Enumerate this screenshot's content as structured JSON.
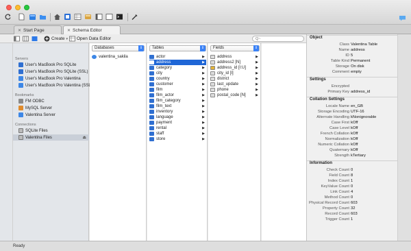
{
  "tabs": [
    {
      "label": "Start Page",
      "active": false
    },
    {
      "label": "Schema Editor",
      "active": true
    }
  ],
  "secondary_toolbar": {
    "create_label": "Create",
    "open_data_editor_label": "Open Data Editor",
    "search_placeholder": "Q~"
  },
  "sidebar": {
    "servers_header": "Servers",
    "servers": [
      "User's MacBook Pro SQLite",
      "User's MacBook Pro SQLite (SSL)",
      "User's MacBook Pro Valentina",
      "User's MacBook Pro Valentina (SSL)"
    ],
    "bookmarks_header": "Bookmarks",
    "bookmarks": [
      "FM ODBC",
      "MySQL Server",
      "Valentina Server"
    ],
    "connections_header": "Connections",
    "connections": [
      "SQLite Files",
      "Valentina Files"
    ]
  },
  "databases": {
    "header": "Databases",
    "items": [
      "valentina_sakila"
    ]
  },
  "tables": {
    "header": "Tables",
    "items": [
      "actor",
      "address",
      "category",
      "city",
      "country",
      "customer",
      "film",
      "film_actor",
      "film_category",
      "film_text",
      "inventory",
      "language",
      "payment",
      "rental",
      "staff",
      "store"
    ],
    "selected": "address"
  },
  "fields": {
    "header": "Fields",
    "items": [
      "address",
      "address2 [N]",
      "address_id [I:U]",
      "city_id [I]",
      "district",
      "last_update",
      "phone",
      "postal_code [N]"
    ]
  },
  "inspector": {
    "object_title": "Object",
    "object": [
      {
        "k": "Class",
        "v": "Valentina Table"
      },
      {
        "k": "Name",
        "v": "address"
      },
      {
        "k": "ID",
        "v": "5"
      },
      {
        "k": "Table Kind",
        "v": "Permanent"
      },
      {
        "k": "Storage",
        "v": "On disk"
      },
      {
        "k": "Comment",
        "v": "empty"
      }
    ],
    "settings_title": "Settings",
    "settings": [
      {
        "k": "Encrypted",
        "v": ""
      },
      {
        "k": "Primary Key",
        "v": "address_id"
      }
    ],
    "collation_title": "Collation Settings",
    "collation": [
      {
        "k": "Locale Name",
        "v": "en_GB"
      },
      {
        "k": "Storage Encoding",
        "v": "UTF-16"
      },
      {
        "k": "Alternate Handling",
        "v": "kNonignorable"
      },
      {
        "k": "Case First",
        "v": "kOff"
      },
      {
        "k": "Case Level",
        "v": "kOff"
      },
      {
        "k": "French Collation",
        "v": "kOff"
      },
      {
        "k": "Normalization",
        "v": "kOff"
      },
      {
        "k": "Numeric Collation",
        "v": "kOff"
      },
      {
        "k": "Quaternary",
        "v": "kOff"
      },
      {
        "k": "Strength",
        "v": "kTertiary"
      }
    ],
    "information_title": "Information",
    "information": [
      {
        "k": "Check Count",
        "v": "0"
      },
      {
        "k": "Field Count",
        "v": "8"
      },
      {
        "k": "Index Count",
        "v": "1"
      },
      {
        "k": "KeyValue Count",
        "v": "0"
      },
      {
        "k": "Link Count",
        "v": "4"
      },
      {
        "k": "Method Count",
        "v": "0"
      },
      {
        "k": "Physical Record Count",
        "v": "603"
      },
      {
        "k": "Property Count",
        "v": "32"
      },
      {
        "k": "Record Count",
        "v": "603"
      },
      {
        "k": "Trigger Count",
        "v": "1"
      }
    ]
  },
  "status": {
    "text": "Ready"
  }
}
